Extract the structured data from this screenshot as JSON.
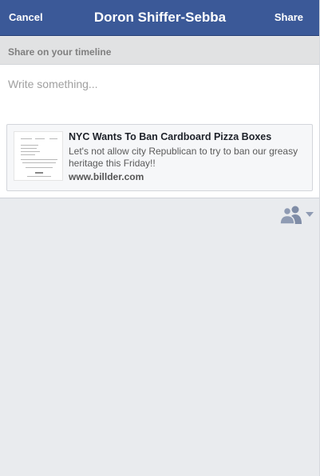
{
  "nav": {
    "cancel_label": "Cancel",
    "title": "Doron Shiffer-Sebba",
    "share_label": "Share"
  },
  "section": {
    "label": "Share on your timeline"
  },
  "composer": {
    "placeholder": "Write something...",
    "value": ""
  },
  "link_preview": {
    "title": "NYC Wants To Ban Cardboard Pizza Boxes",
    "description": "Let's not allow city Republican to try to ban our greasy heritage this Friday!!",
    "domain": "www.billder.com"
  },
  "audience": {
    "icon": "friends-icon",
    "caret_icon": "caret-down-icon"
  },
  "colors": {
    "nav_bg": "#3b5998",
    "page_bg": "#e9ebee",
    "section_bg": "#e1e2e3",
    "card_bg": "#f6f7f9"
  }
}
